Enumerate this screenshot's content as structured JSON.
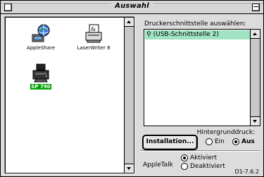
{
  "window": {
    "title": "Auswahl"
  },
  "drivers": [
    {
      "label": "AppleShare",
      "icon": "appleshare-globe-icon",
      "selected": false
    },
    {
      "label": "LaserWriter 8",
      "icon": "laserwriter-printer-icon",
      "selected": false
    },
    {
      "label": "SP 790",
      "icon": "epson-printer-icon",
      "selected": true
    }
  ],
  "port": {
    "heading": "Druckerschnittstelle auswählen:",
    "items": [
      {
        "label": "(USB-Schnittstelle 2)",
        "icon": "usb-icon",
        "selected": true
      }
    ]
  },
  "background_printing": {
    "label": "Hintergrunddruck:",
    "on_label": "Ein",
    "off_label": "Aus",
    "selected": "Aus"
  },
  "setup_button": {
    "label": "Installation..."
  },
  "appletalk": {
    "label": "AppleTalk",
    "active_label": "Aktiviert",
    "inactive_label": "Deaktiviert",
    "selected": "Aktiviert"
  },
  "version": "D1-7.6.2",
  "colors": {
    "selection_green": "#00a000",
    "list_highlight": "#9fe3c2"
  }
}
